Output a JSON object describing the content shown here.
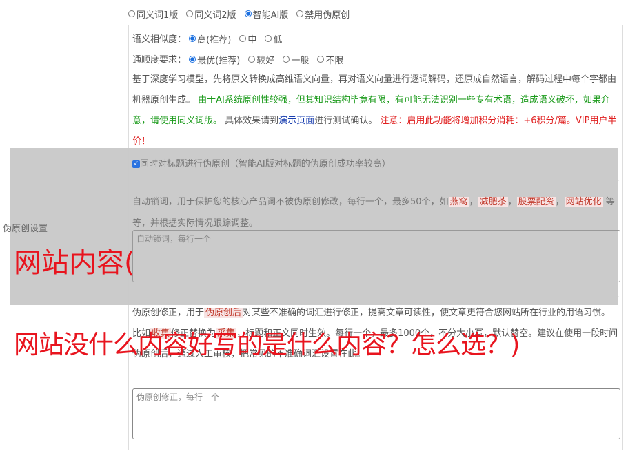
{
  "modes": [
    {
      "label": "同义词1版",
      "checked": false
    },
    {
      "label": "同义词2版",
      "checked": false
    },
    {
      "label": "智能AI版",
      "checked": true
    },
    {
      "label": "禁用伪原创",
      "checked": false
    }
  ],
  "similarity": {
    "label": "语义相似度：",
    "options": [
      {
        "label": "高(推荐)",
        "checked": true
      },
      {
        "label": "中",
        "checked": false
      },
      {
        "label": "低",
        "checked": false
      }
    ]
  },
  "fluency": {
    "label": "通顺度要求：",
    "options": [
      {
        "label": "最优(推荐)",
        "checked": true
      },
      {
        "label": "较好",
        "checked": false
      },
      {
        "label": "一般",
        "checked": false
      },
      {
        "label": "不限",
        "checked": false
      }
    ]
  },
  "description": {
    "intro": "基于深度学习模型，先将原文转换成高维语义向量，再对语义向量进行逐词解码，还原成自然语言，解码过程中每个字都由机器原创生成。",
    "green": "由于AI系统原创性较强，但其知识结构毕竟有限，有可能无法识别一些专有术语，造成语义破坏，如果介意，请使用同义词版。",
    "effect_prefix": "具体效果请到",
    "demo_link": "演示页面",
    "effect_suffix": "进行测试确认。",
    "warning": "注意：启用此功能将增加积分消耗：+6积分/篇。VIP用户半价！"
  },
  "title_option": {
    "label": "同时对标题进行伪原创（智能AI版对标题的伪原创成功率较高）",
    "checked": true
  },
  "lock_words": {
    "desc_prefix": "自动锁词，用于保护您的核心产品词不被伪原创修改，每行一个，最多50个，如",
    "examples": [
      "燕窝",
      "减肥茶",
      "股票配资",
      "网站优化"
    ],
    "desc_suffix": "等等，并根据实际情况跟踪调整。",
    "placeholder": "自动锁词，每行一个"
  },
  "side_label": "伪原创设置",
  "correction": {
    "desc_1": "伪原创修正，用于",
    "tag": "伪原创后",
    "desc_2": "对某些不准确的词汇进行修正，提高文章可读性，使文章更符合您网站所在行业的用语习惯。比如",
    "ex1": "收集",
    "mid": "修正替换为",
    "ex2": "采集",
    "desc_3": "，标题和正文同时生效。每行一个，最多1000个，不分大小写，默认替空。建议在使用一段时间伪原创后，通过人工审核，把常见的不准确词汇设置在此。",
    "placeholder": "伪原创修正，每行一个"
  },
  "overlay_text": {
    "line1": "网站内容(",
    "line2": "网站没什么内容好写的是什么内容？怎么选？)"
  },
  "colors": {
    "accent": "#1a6fe0",
    "green": "#1a9a1a",
    "red": "#e02020",
    "link": "#1a3fb0",
    "overlay": "#c9c9c9",
    "big_red": "#e8141e"
  }
}
